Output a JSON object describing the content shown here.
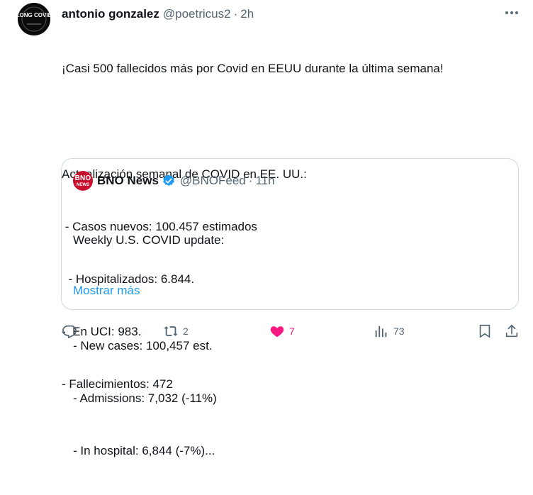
{
  "tweet": {
    "author": {
      "name": "antonio gonzalez",
      "handle": "@poetricus2",
      "separator": "·",
      "time": "2h",
      "avatar_text": "LONG COVID",
      "avatar_icon": "long-covid-avatar"
    },
    "more_icon": "more-dots-icon",
    "text_lines": [
      "¡Casi 500 fallecidos más por Covid en EEUU durante la última semana!",
      "",
      "Actualización semanal de COVID en EE. UU.:",
      " - Casos nuevos: 100.457 estimados",
      "  - Hospitalizados: 6.844.",
      "-  En UCI: 983.",
      "- Fallecimientos: 472"
    ],
    "quote": {
      "avatar_text": "BNO",
      "avatar_subtext": "NEWS",
      "name": "BNO News",
      "verified": true,
      "handle": "@BNOFeed",
      "separator": "·",
      "time": "11h",
      "text_lines": [
        "Weekly U.S. COVID update:",
        "",
        "- New cases: 100,457 est.",
        "- Admissions: 7,032 (-11%)",
        "- In hospital: 6,844 (-7%)..."
      ],
      "show_more": "Mostrar más"
    },
    "actions": {
      "reply": {
        "icon": "reply-icon",
        "count": ""
      },
      "retweet": {
        "icon": "retweet-icon",
        "count": "2"
      },
      "like": {
        "icon": "heart-icon",
        "count": "7",
        "liked": true
      },
      "views": {
        "icon": "views-icon",
        "count": "73"
      },
      "bookmark": {
        "icon": "bookmark-icon"
      },
      "share": {
        "icon": "share-icon"
      }
    }
  },
  "colors": {
    "text": "#0f1419",
    "secondary": "#536471",
    "link": "#1d9bf0",
    "like": "#f91880",
    "border": "#cfd9de",
    "bno_red": "#c8102e"
  }
}
